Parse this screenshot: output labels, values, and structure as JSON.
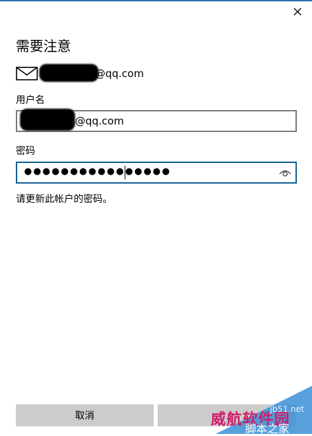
{
  "dialog": {
    "title": "需要注意",
    "account_email": "@qq.com",
    "username_label": "用户名",
    "username_value": "@qq.com",
    "password_label": "密码",
    "password_dots": "●●●●●●●●●●●●●●●●",
    "message": "请更新此帐户的密码。"
  },
  "buttons": {
    "cancel_label": "取消",
    "save_label": ""
  },
  "watermark": {
    "line1": "威航软件园",
    "line2": "脚本之家",
    "line3": "jb51.net"
  },
  "colors": {
    "accent": "#0f5f93",
    "button_bg": "#cccccc"
  },
  "icons": {
    "close": "close-icon",
    "mail": "mail-icon",
    "eye": "eye-icon"
  }
}
